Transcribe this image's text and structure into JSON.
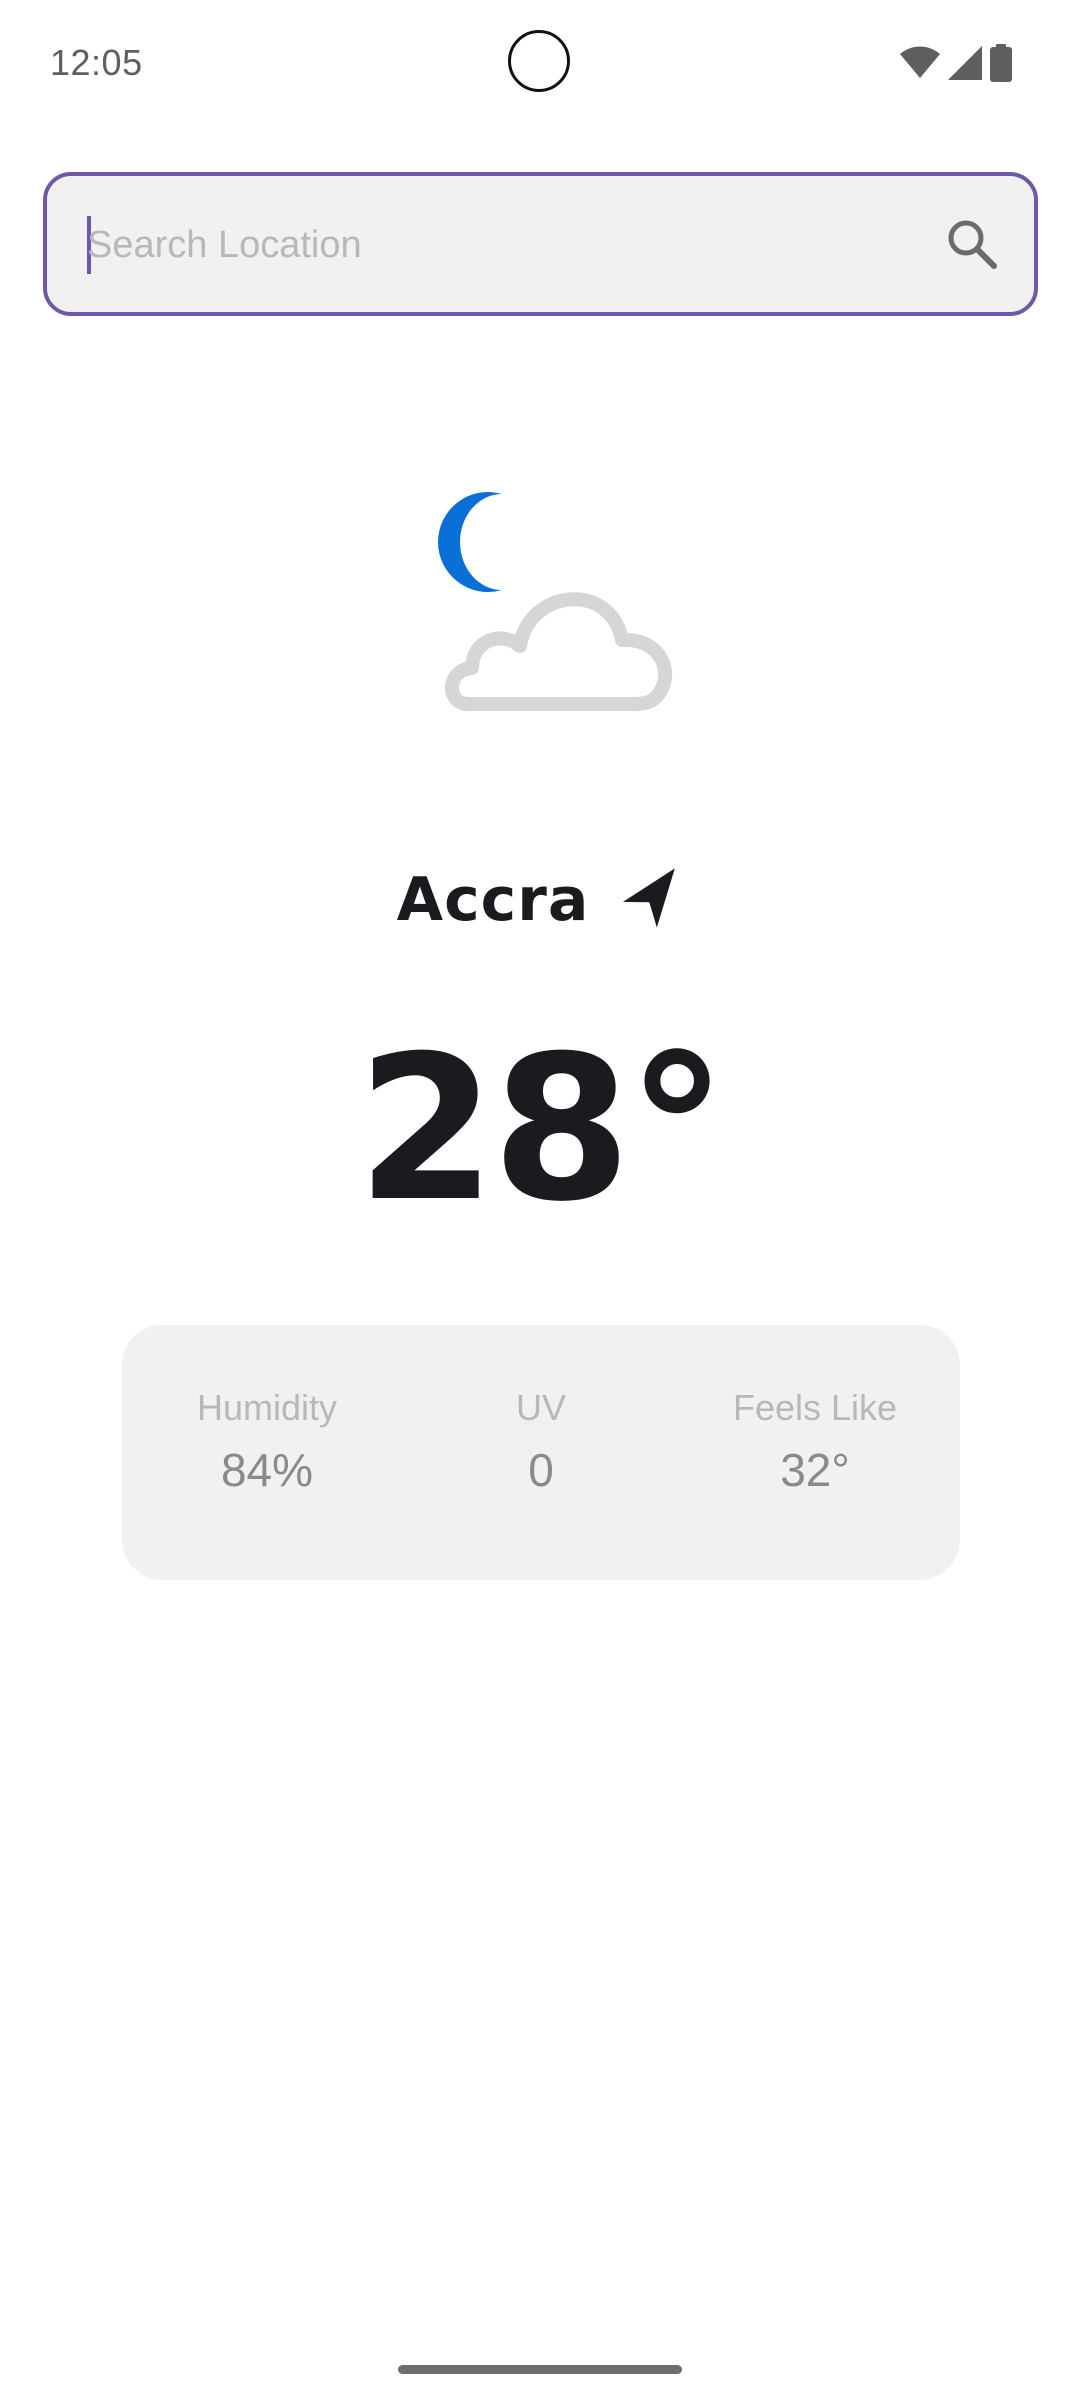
{
  "status_bar": {
    "time": "12:05",
    "icons": [
      "wifi-icon",
      "cell-signal-icon",
      "battery-icon"
    ]
  },
  "search": {
    "placeholder": "Search Location",
    "value": "",
    "icon": "search-icon",
    "accent_color": "#6f58a8"
  },
  "weather": {
    "condition_icon": "moon-cloud-icon",
    "city": "Accra",
    "location_icon": "navigation-arrow-icon",
    "temperature": "28°"
  },
  "stats": {
    "humidity": {
      "label": "Humidity",
      "value": "84%"
    },
    "uv": {
      "label": "UV",
      "value": "0"
    },
    "feels_like": {
      "label": "Feels Like",
      "value": "32°"
    }
  },
  "colors": {
    "moon": "#0a6fd6",
    "cloud": "#d6d6d6",
    "text_dark": "#1b1b1f",
    "card_bg": "#f1f1f1"
  }
}
